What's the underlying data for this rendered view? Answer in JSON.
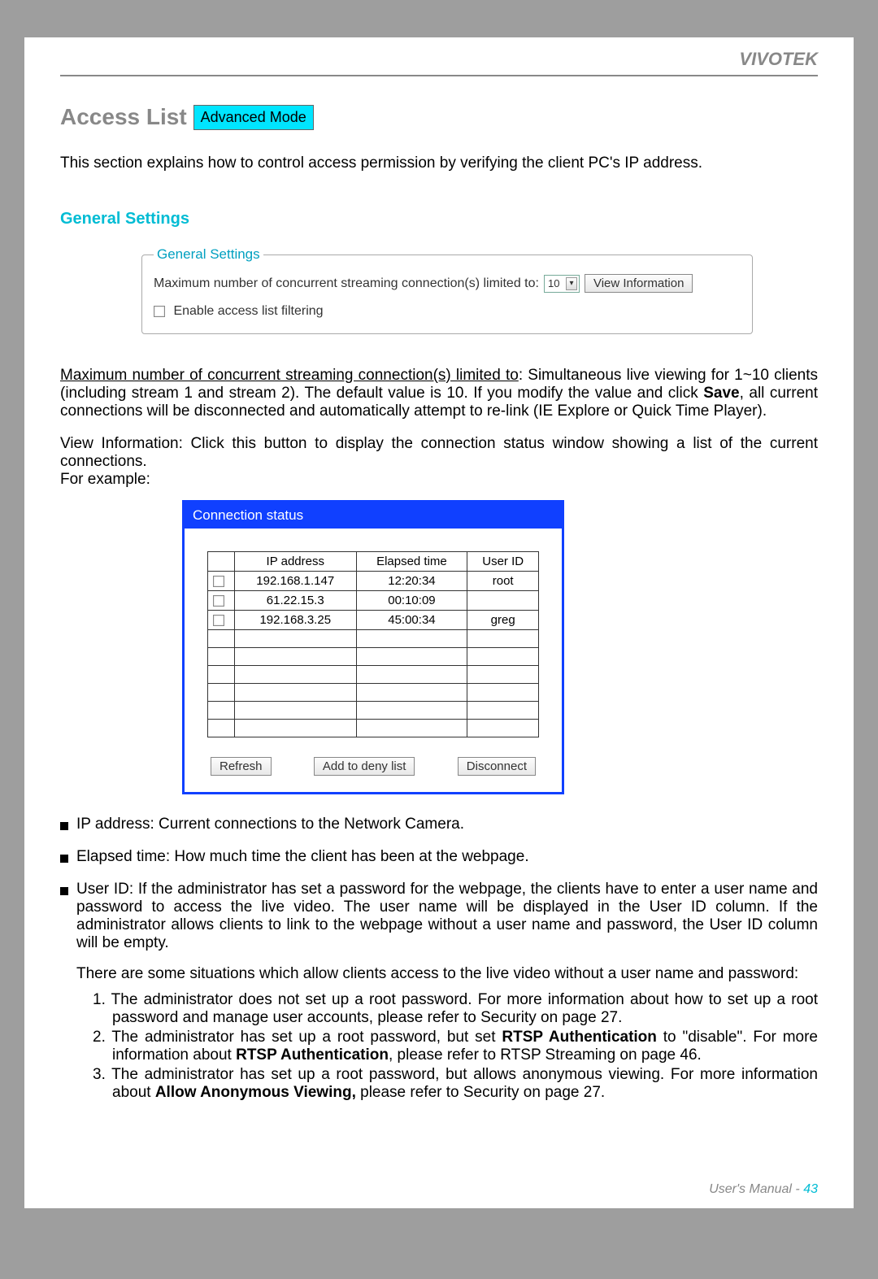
{
  "header": {
    "brand": "VIVOTEK"
  },
  "title": {
    "text": "Access List",
    "badge": "Advanced Mode"
  },
  "intro": "This section explains how to control access permission by verifying the client PC's IP address.",
  "section": {
    "heading": "General Settings",
    "fieldset_legend": "General Settings",
    "max_conn_label": "Maximum number of concurrent streaming connection(s) limited to:",
    "max_conn_value": "10",
    "view_info_btn": "View Information",
    "enable_filter": "Enable access list filtering"
  },
  "para_maxconn": {
    "lead": "Maximum number of concurrent streaming connection(s) limited to",
    "body": ": Simultaneous live viewing for 1~10 clients (including stream 1 and stream 2). The default value is 10. If you modify the value and click ",
    "save": "Save",
    "tail": ", all current connections will be disconnected and automatically attempt to re-link (IE Explore or Quick Time Player)."
  },
  "para_viewinfo": {
    "lead": "View Information",
    "body": ": Click this button to display the connection status window showing a list of the current connections.",
    "example": "For example:"
  },
  "conn": {
    "title": "Connection status",
    "headers": [
      "IP address",
      "Elapsed time",
      "User ID"
    ],
    "rows": [
      {
        "ip": "192.168.1.147",
        "time": "12:20:34",
        "user": "root"
      },
      {
        "ip": "61.22.15.3",
        "time": "00:10:09",
        "user": ""
      },
      {
        "ip": "192.168.3.25",
        "time": "45:00:34",
        "user": "greg"
      }
    ],
    "buttons": {
      "refresh": "Refresh",
      "deny": "Add to deny list",
      "disconnect": "Disconnect"
    }
  },
  "bullets": {
    "ip": "IP address: Current connections to the Network Camera.",
    "elapsed": "Elapsed time: How much time the client has been at the webpage.",
    "userid": "User ID: If the administrator has set a password for the webpage, the clients have to enter a user name and password to access the live video. The user name will be displayed in the User ID column. If  the administrator allows clients to link to the webpage without a user name and password, the User ID column will be empty.",
    "situations": "There are some situations which allow clients access to the live video without a user name and password:"
  },
  "numbered": {
    "n1": "1. The administrator does not set up a root password. For more information about how to set up a root password and manage user accounts, please refer to Security on page 27.",
    "n2a": "2. The administrator has set up a root password, but set ",
    "n2b": "RTSP Authentication",
    "n2c": " to \"disable\". For more information about ",
    "n2d": "RTSP Authentication",
    "n2e": ", please refer to RTSP Streaming on page 46.",
    "n3a": "3. The administrator has set up a root password, but allows anonymous viewing. For more information about ",
    "n3b": "Allow Anonymous Viewing,",
    "n3c": " please refer to Security on page 27."
  },
  "footer": {
    "label": "User's Manual - ",
    "page": "43"
  }
}
